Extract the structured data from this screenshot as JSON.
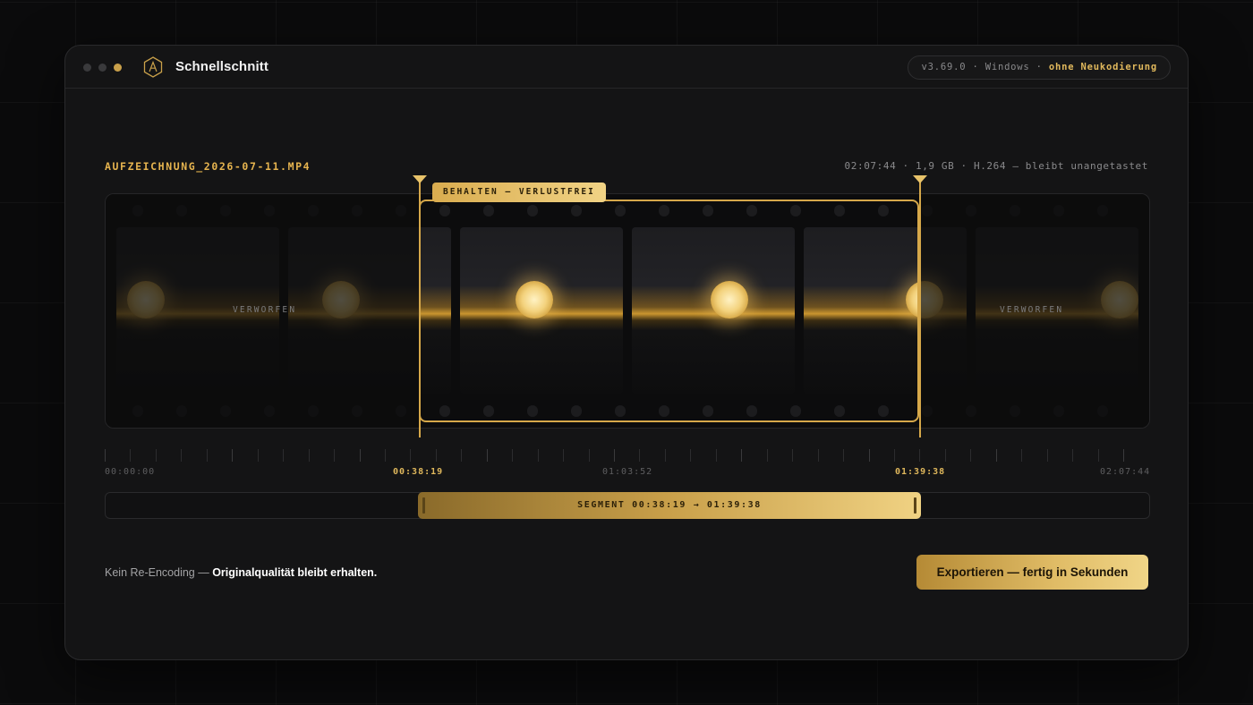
{
  "app": {
    "title": "Schnellschnitt",
    "version_info": "v3.69.0 · Windows · ",
    "version_highlight": "ohne Neukodierung",
    "accent_color": "#e0b85c"
  },
  "file": {
    "name": "AUFZEICHNUNG_2026-07-11.MP4",
    "info": "02:07:44 · 1,9 GB · H.264 — bleibt unangetastet"
  },
  "filmstrip": {
    "keep_tag": "BEHALTEN — VERLUSTFREI",
    "discard_label": "VERWORFEN"
  },
  "timeline": {
    "labels": [
      "00:00:00",
      "00:38:19",
      "01:03:52",
      "01:39:38",
      "02:07:44"
    ],
    "in_point": "00:38:19",
    "out_point": "01:39:38"
  },
  "segment": {
    "label": "SEGMENT 00:38:19 → 01:39:38"
  },
  "footer": {
    "note_prefix": "Kein Re-Encoding — ",
    "note_bold": "Originalqualität bleibt erhalten.",
    "export_label": "Exportieren — fertig in Sekunden"
  }
}
